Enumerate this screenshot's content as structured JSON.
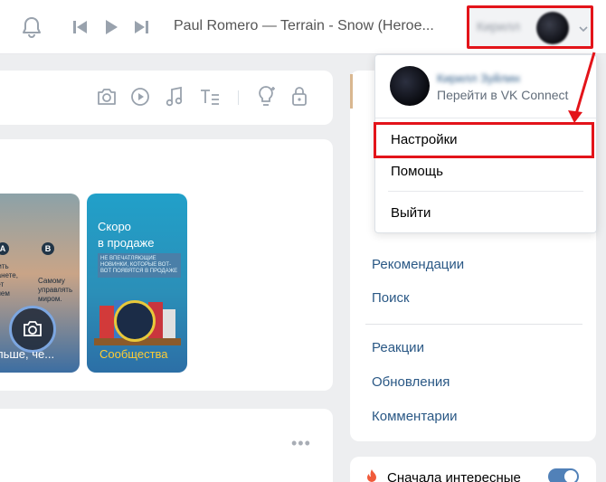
{
  "player": {
    "track_title": "Paul Romero — Terrain - Snow (Heroe..."
  },
  "user": {
    "name": "Кирилл",
    "full_name": "Кирилл Зуйлин",
    "connect_label": "Перейти в VK Connect"
  },
  "dropdown": {
    "items": [
      {
        "label": "Настройки"
      },
      {
        "label": "Помощь"
      },
      {
        "label": "Выйти"
      }
    ]
  },
  "stories": [
    {
      "caption": "льше, че..."
    },
    {
      "title_line1": "Скоро",
      "title_line2": "в продаже",
      "banner": "НЕ ВПЕЧАТЛЯЮЩИЕ НОВИНКИ, КОТОРЫЕ ВОТ-ВОТ ПОЯВЯТСЯ В ПРОДАЖЕ",
      "caption": "Сообщества"
    }
  ],
  "story1_text": {
    "badge_a": "A",
    "badge_b": "B",
    "left_text": "жить\nланете,\nнет\nблем",
    "right_text": "Самому\nуправлять\nмиром."
  },
  "right_menu": {
    "items": [
      {
        "label": "Рекомендации"
      },
      {
        "label": "Поиск"
      },
      {
        "label": "Реакции"
      },
      {
        "label": "Обновления"
      },
      {
        "label": "Комментарии"
      }
    ]
  },
  "feed_filter": {
    "label": "Сначала интересные",
    "enabled": true
  },
  "colors": {
    "highlight": "#e3141a",
    "link": "#2a5885",
    "toggle_on": "#5181b8"
  },
  "icons": [
    "bell-icon",
    "previous-icon",
    "play-icon",
    "next-icon",
    "chevron-down-icon",
    "camera-icon",
    "video-icon",
    "music-icon",
    "text-format-icon",
    "lightbulb-icon",
    "lock-icon",
    "fire-icon",
    "more-icon"
  ]
}
